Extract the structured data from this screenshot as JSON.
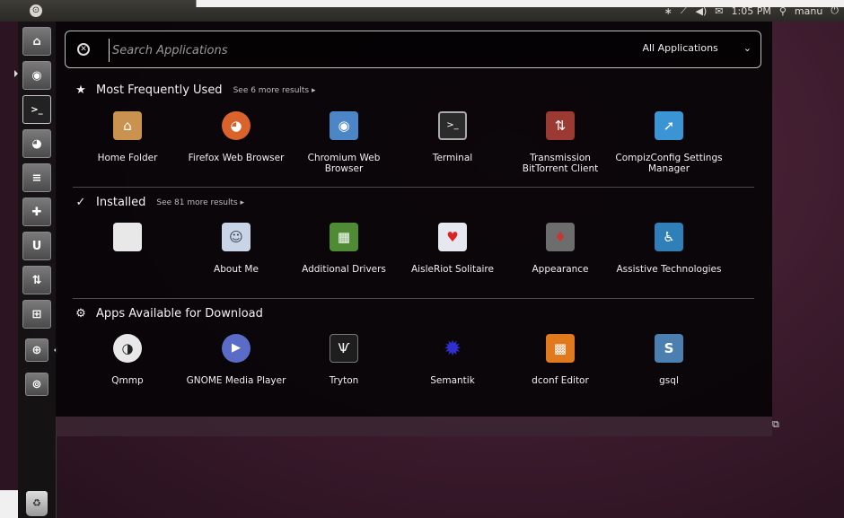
{
  "panel": {
    "dash_glyph": "⊙",
    "time": "1:05 PM",
    "user": "manu",
    "icons": [
      "bluetooth-icon",
      "network-icon",
      "volume-icon",
      "mail-icon",
      "user-icon",
      "power-icon"
    ]
  },
  "launcher": {
    "items": [
      {
        "name": "launcher-home-folder",
        "glyph": "⌂"
      },
      {
        "name": "launcher-chromium",
        "glyph": "◉"
      },
      {
        "name": "launcher-terminal",
        "glyph": ">_"
      },
      {
        "name": "launcher-firefox",
        "glyph": "◕"
      },
      {
        "name": "launcher-text-editor",
        "glyph": "≡"
      },
      {
        "name": "launcher-software-center",
        "glyph": "✚"
      },
      {
        "name": "launcher-ubuntu-one",
        "glyph": "U"
      },
      {
        "name": "launcher-transmission",
        "glyph": "⇅"
      },
      {
        "name": "launcher-workspaces",
        "glyph": "⊞"
      },
      {
        "name": "launcher-apps-lens",
        "glyph": "⊕"
      },
      {
        "name": "launcher-files-lens",
        "glyph": "⊚"
      }
    ],
    "trash_glyph": "♻"
  },
  "search": {
    "placeholder": "Search Applications",
    "filter_label": "All Applications",
    "filter_chevron": "⌄",
    "clear_glyph": "✕"
  },
  "sections": [
    {
      "title": "Most Frequently Used",
      "see_more": "See 6 more results",
      "icon": "★",
      "apps": [
        {
          "label": "Home Folder",
          "glyph": "⌂",
          "color": "#c9934f"
        },
        {
          "label": "Firefox Web Browser",
          "glyph": "◕",
          "color": "#d9632a"
        },
        {
          "label": "Chromium Web Browser",
          "glyph": "◉",
          "color": "#4c86c6"
        },
        {
          "label": "Terminal",
          "glyph": ">_",
          "color": "#2b2b2b"
        },
        {
          "label": "Transmission BitTorrent Client",
          "glyph": "⇅",
          "color": "#9b3a33"
        },
        {
          "label": "CompizConfig Settings Manager",
          "glyph": "➚",
          "color": "#3b95d4"
        }
      ]
    },
    {
      "title": "Installed",
      "see_more": "See 81 more results",
      "icon": "✓",
      "apps": [
        {
          "label": "",
          "glyph": "",
          "color": "#e8e8e8"
        },
        {
          "label": "About Me",
          "glyph": "☺",
          "color": "#c9d4e6"
        },
        {
          "label": "Additional Drivers",
          "glyph": "▦",
          "color": "#4f8a35"
        },
        {
          "label": "AisleRiot Solitaire",
          "glyph": "♥",
          "color": "#e7e7f0"
        },
        {
          "label": "Appearance",
          "glyph": "♦",
          "color": "#6d6d6d"
        },
        {
          "label": "Assistive Technologies",
          "glyph": "♿",
          "color": "#2f80b9"
        }
      ]
    },
    {
      "title": "Apps Available for Download",
      "see_more": "",
      "icon": "⚙",
      "apps": [
        {
          "label": "Qmmp",
          "glyph": "◑",
          "color": "#e8e8e8"
        },
        {
          "label": "GNOME Media Player",
          "glyph": "▶",
          "color": "#5b6cc8"
        },
        {
          "label": "Tryton",
          "glyph": "Ѱ",
          "color": "#1e1e1e"
        },
        {
          "label": "Semantik",
          "glyph": "✹",
          "color": "#1a1a9a"
        },
        {
          "label": "dconf Editor",
          "glyph": "▩",
          "color": "#e07a1c"
        },
        {
          "label": "gsql",
          "glyph": "S",
          "color": "#4a7fb0"
        }
      ]
    }
  ]
}
